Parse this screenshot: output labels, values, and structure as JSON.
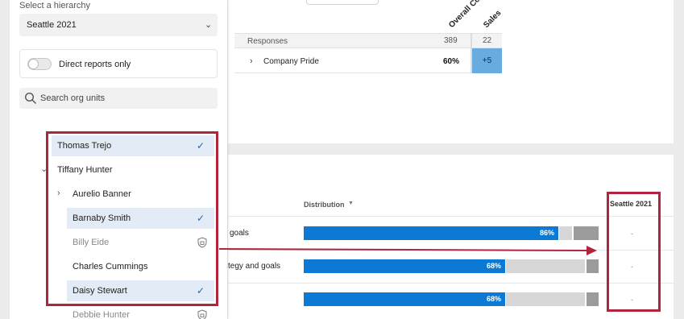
{
  "hierarchy": {
    "label": "Select a hierarchy",
    "selected": "Seattle 2021"
  },
  "toggle": {
    "label": "Direct reports only",
    "on": false
  },
  "search": {
    "placeholder": "Search org units"
  },
  "tree": [
    {
      "label": "Thomas Trejo",
      "selected": true,
      "icon": "check-icon"
    },
    {
      "label": "Tiffany Hunter",
      "selected": false,
      "expanded": true
    },
    {
      "label": "Aurelio Banner",
      "selected": false,
      "expandable": true
    },
    {
      "label": "Barnaby Smith",
      "selected": true,
      "icon": "check-icon"
    },
    {
      "label": "Billy Eide",
      "selected": false,
      "disabled": true,
      "icon": "shield-icon"
    },
    {
      "label": "Charles Cummings",
      "selected": false
    },
    {
      "label": "Daisy Stewart",
      "selected": true,
      "icon": "check-icon"
    },
    {
      "label": "Debbie Hunter",
      "selected": false,
      "disabled": true,
      "icon": "shield-icon"
    }
  ],
  "table_top": {
    "columns": [
      "Overall Co",
      "Sales"
    ],
    "responses": {
      "label": "Responses",
      "overall": "389",
      "sales": "22"
    },
    "rows": [
      {
        "label": "Company Pride",
        "overall": "60%",
        "sales": "+5"
      }
    ]
  },
  "table_bottom": {
    "distribution_label": "Distribution",
    "comparison_label": "Seattle 2021",
    "rows": [
      {
        "statement": "goals",
        "favorable": "86%",
        "fav_fraction": 0.86,
        "comparison": "-"
      },
      {
        "statement": "tegy and goals",
        "favorable": "68%",
        "fav_fraction": 0.68,
        "comparison": "-"
      },
      {
        "statement": "",
        "favorable": "68%",
        "fav_fraction": 0.68,
        "comparison": "-"
      }
    ]
  },
  "colors": {
    "accent": "#0c7ad4",
    "highlight": "#b0253c",
    "selected_bg": "#e3ebf6",
    "heat_cell": "#68acdf"
  }
}
